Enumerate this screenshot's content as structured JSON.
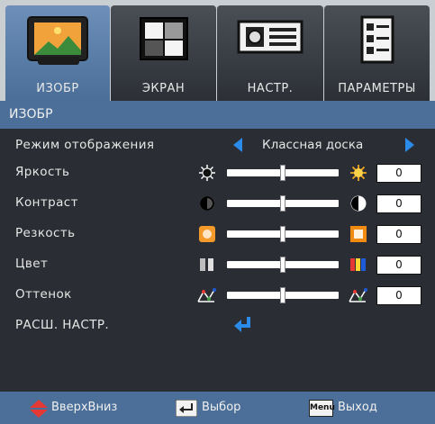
{
  "tabs": [
    {
      "label": "ИЗОБР",
      "icon": "picture-icon",
      "active": true
    },
    {
      "label": "ЭКРАН",
      "icon": "screen-icon",
      "active": false
    },
    {
      "label": "НАСТР.",
      "icon": "projector-icon",
      "active": false
    },
    {
      "label": "ПАРАМЕТРЫ",
      "icon": "options-document-icon",
      "active": false
    }
  ],
  "section_title": "ИЗОБР",
  "display_mode": {
    "label": "Режим отображения",
    "value": "Классная доска"
  },
  "settings": [
    {
      "key": "brightness",
      "label": "Яркость",
      "value": "0",
      "level": 0.5,
      "low_icon": "sun-dim-icon",
      "high_icon": "sun-bright-icon"
    },
    {
      "key": "contrast",
      "label": "Контраст",
      "value": "0",
      "level": 0.5,
      "low_icon": "contrast-low-icon",
      "high_icon": "contrast-high-icon"
    },
    {
      "key": "sharpness",
      "label": "Резкость",
      "value": "0",
      "level": 0.5,
      "low_icon": "sharpness-low-icon",
      "high_icon": "sharpness-high-icon"
    },
    {
      "key": "color",
      "label": "Цвет",
      "value": "0",
      "level": 0.5,
      "low_icon": "color-low-icon",
      "high_icon": "color-high-icon"
    },
    {
      "key": "tint",
      "label": "Оттенок",
      "value": "0",
      "level": 0.5,
      "low_icon": "tint-low-icon",
      "high_icon": "tint-high-icon"
    }
  ],
  "advanced": {
    "label": "РАСШ. НАСТР.",
    "icon": "enter-icon"
  },
  "footer": {
    "updown_label": "ВверхВниз",
    "select_label": "Выбор",
    "menu_key": "Menu",
    "exit_label": "Выход"
  },
  "colors": {
    "accent": "#2a8be8",
    "header": "#4b6f98",
    "background": "#2a2d33"
  }
}
